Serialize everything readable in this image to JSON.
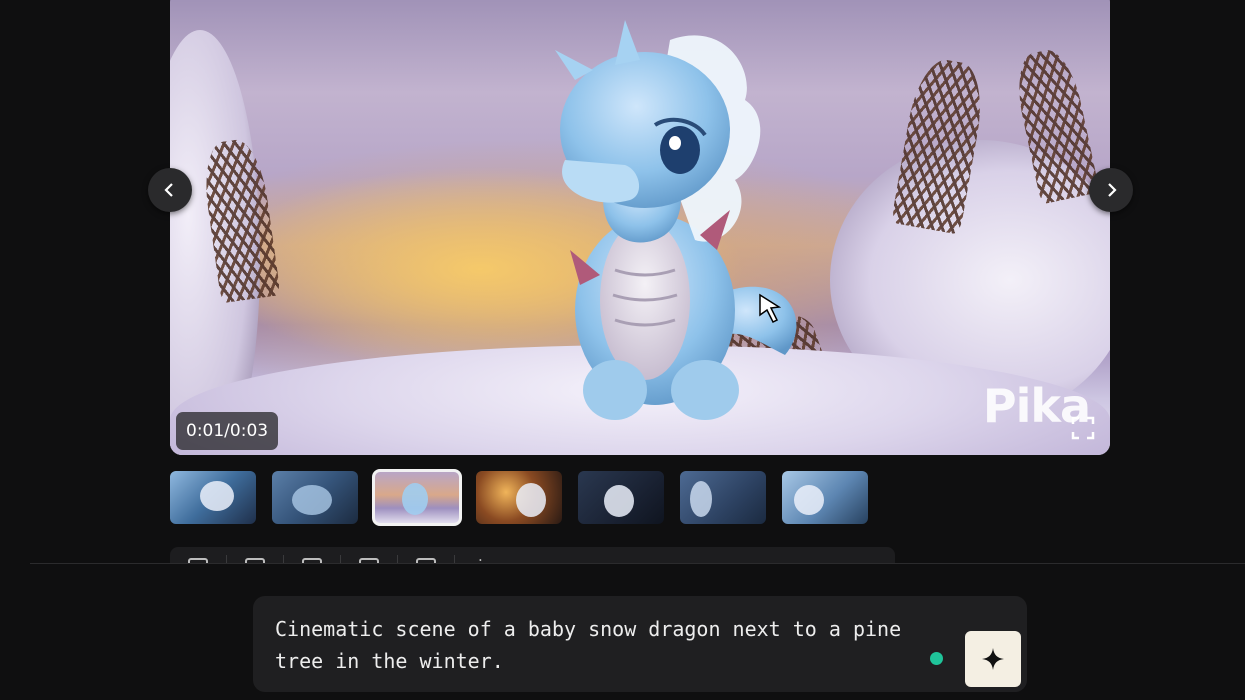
{
  "player": {
    "time": "0:01/0:03",
    "watermark": "Pika"
  },
  "thumbnails": [
    {
      "label": "thumbnail-1",
      "active": false
    },
    {
      "label": "thumbnail-2",
      "active": false
    },
    {
      "label": "thumbnail-3",
      "active": true
    },
    {
      "label": "thumbnail-4",
      "active": false
    },
    {
      "label": "thumbnail-5",
      "active": false
    },
    {
      "label": "thumbnail-6",
      "active": false
    },
    {
      "label": "thumbnail-7",
      "active": false
    }
  ],
  "prompt": {
    "text": "Cinematic scene of a baby snow dragon next to a pine tree in the winter."
  },
  "colors": {
    "background": "#0f0f10",
    "status": "#1fc49a",
    "generate_button": "#f4efe3"
  },
  "icons": {
    "previous": "chevron-left-icon",
    "next": "chevron-right-icon",
    "generate": "sparkle-icon",
    "fullscreen": "fullscreen-icon",
    "delete": "trash-icon"
  }
}
